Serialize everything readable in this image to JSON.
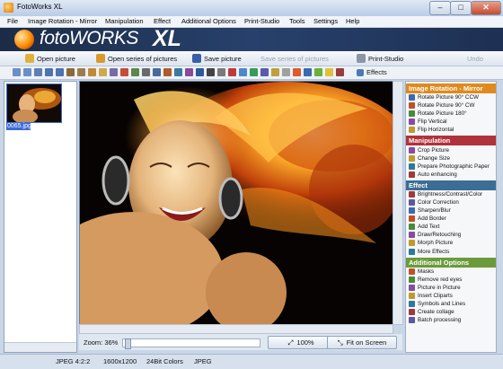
{
  "window": {
    "title": "FotoWorks XL",
    "controls": [
      "–",
      "□",
      "✕"
    ]
  },
  "menu": [
    "File",
    "Image Rotation - Mirror",
    "Manipulation",
    "Effect",
    "Additional Options",
    "Print-Studio",
    "Tools",
    "Settings",
    "Help"
  ],
  "banner": {
    "logo_main": "fotoWORKS",
    "logo_xl": "XL"
  },
  "commands": {
    "open_picture": "Open picture",
    "open_series": "Open series of pictures",
    "save_picture": "Save picture",
    "save_series": "Save series of pictures",
    "print_studio": "Print-Studio",
    "undo": "Undo"
  },
  "toolbar": {
    "effects_label": "Effects"
  },
  "thumbnail": {
    "filename": "0065.jpg"
  },
  "zoom": {
    "label": "Zoom: 36%",
    "percent": 36,
    "btn_100": "100%",
    "btn_fit": "Fit on Screen"
  },
  "panels": [
    {
      "title": "Image Rotation - Mirror",
      "color": "#e08a1e",
      "items": [
        "Rotate Picture 90° CCW",
        "Rotate Picture 90° CW",
        "Rotate Picture 180°",
        "Flip Vertical",
        "Flip Horizontal"
      ]
    },
    {
      "title": "Manipulation",
      "color": "#b0323a",
      "items": [
        "Crop Picture",
        "Change Size",
        "Prepare Photographic Paper",
        "Auto enhancing"
      ]
    },
    {
      "title": "Effect",
      "color": "#3c6d95",
      "items": [
        "Brightness/Contrast/Color",
        "Color Correction",
        "Sharpen/Blur",
        "Add Border",
        "Add Text",
        "Draw/Retouching",
        "Morph Picture",
        "More Effects"
      ]
    },
    {
      "title": "Additional Options",
      "color": "#6b9a3c",
      "items": [
        "Masks",
        "Remove red eyes",
        "Picture in Picture",
        "Insert Cliparts",
        "Symbols and Lines",
        "Create collage",
        "Batch processing"
      ]
    }
  ],
  "status": {
    "format": "JPEG 4:2:2",
    "dimensions": "1600x1200",
    "colors": "24Bit Colors",
    "type": "JPEG"
  }
}
